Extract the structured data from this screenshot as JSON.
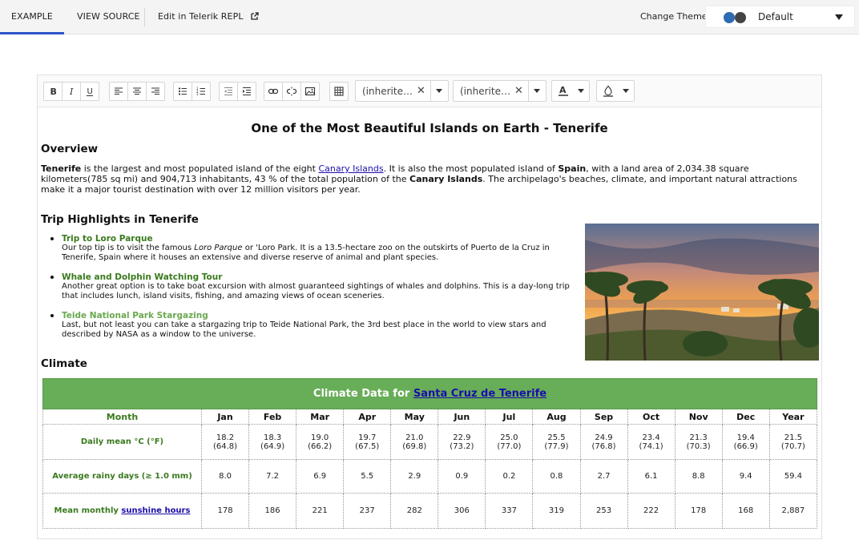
{
  "tabs": {
    "example": "EXAMPLE",
    "view_source": "VIEW SOURCE",
    "edit_repl": "Edit in Telerik REPL"
  },
  "theme": {
    "label": "Change Theme",
    "value": "Default"
  },
  "toolbar": {
    "font_family": "(inherited font)",
    "font_size": "(inherited size)",
    "foreground_glyph": "A",
    "clear_glyph": "✕"
  },
  "doc": {
    "title": "One of the Most Beautiful Islands on Earth - Tenerife",
    "overview_heading": "Overview",
    "overview": {
      "s1": "Tenerife",
      "s2": " is the largest and most populated island of the eight ",
      "link": "Canary Islands",
      "s3": ". It is also the most populated island of ",
      "s4": "Spain",
      "s5": ", with a land area of 2,034.38 square kilometers(785 sq mi) and 904,713 inhabitants, 43 % of the total population of the ",
      "s6": "Canary Islands",
      "s7": ". The archipelago's beaches, climate, and important natural attractions make it a major tourist destination with over 12 million visitors per year."
    },
    "highlights_heading": "Trip Highlights in Tenerife",
    "highlights": [
      {
        "title": "Trip to Loro Parque",
        "pre": "Our top tip is to visit the famous ",
        "em": "Loro Parque",
        "post": " or 'Loro Park. It is a 13.5-hectare zoo on the outskirts of Puerto de la Cruz in Tenerife, Spain where it houses an extensive and diverse reserve of animal and plant species."
      },
      {
        "title": "Whale and Dolphin Watching Tour",
        "text": "Another great option is to take boat excursion with almost guaranteed sightings of whales and dolphins. This is a day-long trip that includes lunch, island visits, fishing, and amazing views of ocean sceneries."
      },
      {
        "title": "Teide National Park Stargazing",
        "text": "Last, but not least you can take a stargazing trip to Teide National Park, the 3rd best place in the world to view stars and described by NASA as a window to the universe."
      }
    ],
    "climate_heading": "Climate"
  },
  "climate_table": {
    "title_prefix": "Climate Data for ",
    "title_link": "Santa Cruz de Tenerife",
    "month_header": "Month",
    "months": [
      "Jan",
      "Feb",
      "Mar",
      "Apr",
      "May",
      "Jun",
      "Jul",
      "Aug",
      "Sep",
      "Oct",
      "Nov",
      "Dec",
      "Year"
    ],
    "rows": [
      {
        "label": "Daily mean °C (°F)",
        "values": [
          [
            "18.2",
            "(64.8)"
          ],
          [
            "18.3",
            "(64.9)"
          ],
          [
            "19.0",
            "(66.2)"
          ],
          [
            "19.7",
            "(67.5)"
          ],
          [
            "21.0",
            "(69.8)"
          ],
          [
            "22.9",
            "(73.2)"
          ],
          [
            "25.0",
            "(77.0)"
          ],
          [
            "25.5",
            "(77.9)"
          ],
          [
            "24.9",
            "(76.8)"
          ],
          [
            "23.4",
            "(74.1)"
          ],
          [
            "21.3",
            "(70.3)"
          ],
          [
            "19.4",
            "(66.9)"
          ],
          [
            "21.5",
            "(70.7)"
          ]
        ]
      },
      {
        "label": "Average rainy days (≥ 1.0 mm)",
        "values": [
          "8.0",
          "7.2",
          "6.9",
          "5.5",
          "2.9",
          "0.9",
          "0.2",
          "0.8",
          "2.7",
          "6.1",
          "8.8",
          "9.4",
          "59.4"
        ]
      },
      {
        "label_prefix": "Mean monthly ",
        "label_link": "sunshine hours",
        "values": [
          "178",
          "186",
          "221",
          "237",
          "282",
          "306",
          "337",
          "319",
          "253",
          "222",
          "178",
          "168",
          "2,887"
        ]
      }
    ]
  }
}
